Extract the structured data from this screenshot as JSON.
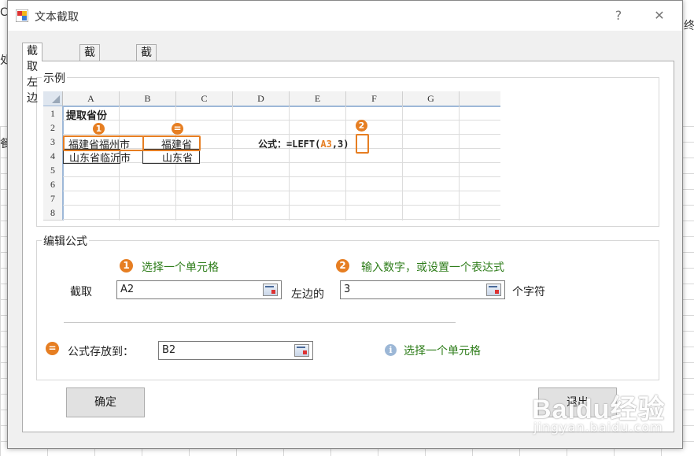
{
  "window": {
    "title": "文本截取",
    "help": "?",
    "close": "✕"
  },
  "background": {
    "frag_top_left": "C",
    "frag_left_1": "处",
    "frag_left_2": "餐",
    "frag_right": "终"
  },
  "tabs": [
    {
      "label": "截取左边",
      "active": true
    },
    {
      "label": "截取中间",
      "active": false
    },
    {
      "label": "截取右边",
      "active": false
    }
  ],
  "example": {
    "group_title": "示例",
    "columns": [
      "A",
      "B",
      "C",
      "D",
      "E",
      "F",
      "G"
    ],
    "rows": [
      "1",
      "2",
      "3",
      "4",
      "5",
      "6",
      "7",
      "8"
    ],
    "a1": "提取省份",
    "a3": "福建省福州市",
    "b3": "福建省",
    "a4": "山东省临沂市",
    "b4": "山东省",
    "formula_prefix": "公式：=LEFT(",
    "formula_ref": "A3",
    "formula_sep": ",",
    "formula_num": "3",
    "formula_suffix": ")",
    "badge1": "1",
    "badge_eq": "=",
    "badge2": "2"
  },
  "edit": {
    "group_title": "编辑公式",
    "hint1_num": "1",
    "hint1": "选择一个单元格",
    "hint2_num": "2",
    "hint2": "输入数字，或设置一个表达式",
    "take_label": "截取",
    "source_value": "A2",
    "left_label": "左边的",
    "count_value": "3",
    "chars_label": "个字符",
    "store_num": "=",
    "store_label": "公式存放到：",
    "target_value": "B2",
    "info_icon": "i",
    "target_hint": "选择一个单元格"
  },
  "buttons": {
    "ok": "确定",
    "exit": "退出"
  },
  "watermark": {
    "main": "Baidu经验",
    "sub": "jingyan.baidu.com"
  },
  "colors": {
    "accent_orange": "#e67e22",
    "hint_green": "#2e7d1a"
  }
}
